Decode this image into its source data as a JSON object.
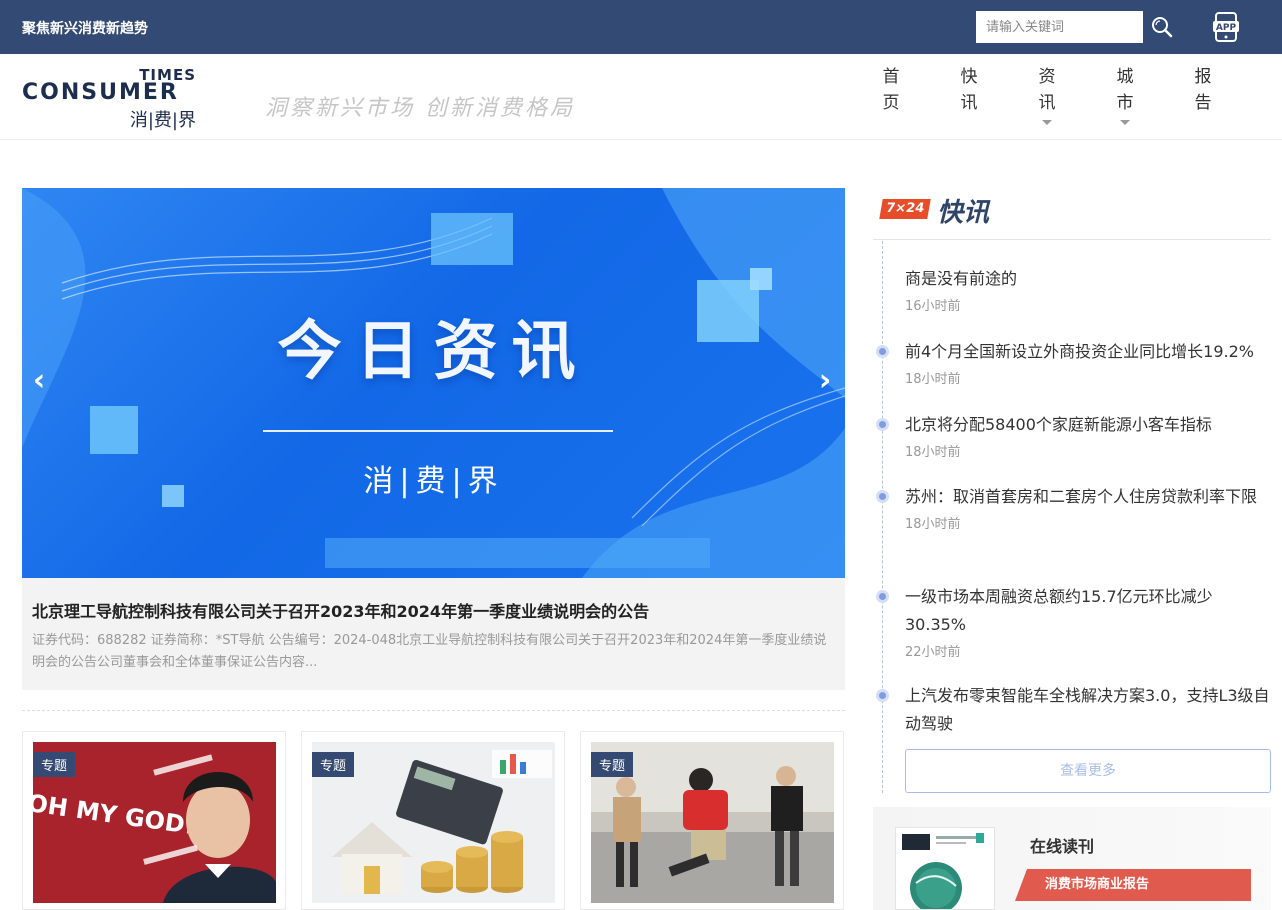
{
  "topbar": {
    "slogan": "聚焦新兴消费新趋势",
    "search_placeholder": "请输入关键词",
    "app_label": "APP"
  },
  "logo": {
    "times": "TIMES",
    "consumer": "CONSUMER",
    "cn": "消|费|界"
  },
  "motto": "洞察新兴市场 创新消费格局",
  "nav": [
    {
      "label": [
        "首",
        "页"
      ],
      "dropdown": false
    },
    {
      "label": [
        "快",
        "讯"
      ],
      "dropdown": false
    },
    {
      "label": [
        "资",
        "讯"
      ],
      "dropdown": true
    },
    {
      "label": [
        "城",
        "市"
      ],
      "dropdown": true
    },
    {
      "label": [
        "报",
        "告"
      ],
      "dropdown": false
    }
  ],
  "carousel": {
    "headline": "今日资讯",
    "brand": "消|费|界",
    "prev": "‹",
    "next": "›"
  },
  "feature": {
    "title": "北京理工导航控制科技有限公司关于召开2023年和2024年第一季度业绩说明会的公告",
    "desc": "证券代码：688282 证券简称：*ST导航 公告编号：2024-048北京工业导航控制科技有限公司关于召开2023年和2024年第一季度业绩说明会的公告公司董事会和全体董事保证公告内容..."
  },
  "cards": [
    {
      "tag": "专题",
      "art": "OH MY GOD!"
    },
    {
      "tag": "专题"
    },
    {
      "tag": "专题"
    }
  ],
  "kuaixun": {
    "badge": "7×24",
    "label": "快讯",
    "items": [
      {
        "title": "商是没有前途的",
        "time": "16小时前"
      },
      {
        "title": "前4个月全国新设立外商投资企业同比增长19.2%",
        "time": "18小时前"
      },
      {
        "title": "北京将分配58400个家庭新能源小客车指标",
        "time": "18小时前"
      },
      {
        "title": "苏州：取消首套房和二套房个人住房贷款利率下限",
        "time": "18小时前"
      },
      {
        "title": "一级市场本周融资总额约15.7亿元环比减少30.35%",
        "time": "22小时前"
      },
      {
        "title": "上汽发布零束智能车全栈解决方案3.0，支持L3级自动驾驶",
        "time": ""
      }
    ],
    "more": "查看更多"
  },
  "reading": {
    "title": "在线读刊",
    "ribbon": "消费市场商业报告"
  },
  "colors": {
    "topbar": "#334a74",
    "accent": "#e84d2a",
    "ribbon": "#e05a4d"
  }
}
